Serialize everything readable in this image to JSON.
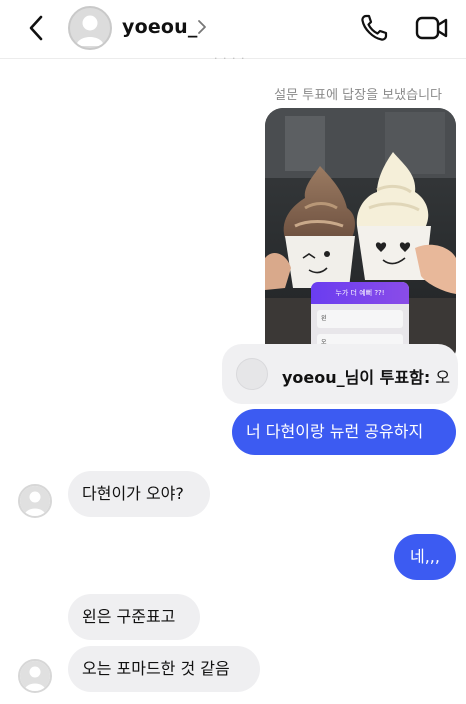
{
  "header": {
    "username": "yoeou_",
    "back_icon": "chevron-left-icon",
    "profile_chevron": "chevron-right-icon",
    "call_icon": "phone-icon",
    "video_icon": "video-camera-icon"
  },
  "thread": {
    "story_reply_meta": "설문 투표에 답장을 보냈습니다",
    "story": {
      "poll_question": "누가 더 예뻐 ??!",
      "poll_options": [
        "왼",
        "오"
      ]
    },
    "vote": {
      "prefix": "yoeou_님이 투표함:",
      "choice": "오"
    },
    "messages": [
      {
        "from": "me",
        "text": "너 다현이랑 뉴런 공유하지"
      },
      {
        "from": "them",
        "text": "다현이가 오야?"
      },
      {
        "from": "me",
        "text": "네,,,"
      },
      {
        "from": "them",
        "text": "왼은 구준표고"
      },
      {
        "from": "them",
        "text": "오는 포마드한 것 같음"
      }
    ]
  },
  "colors": {
    "outgoing_bubble": "#3c5bf2",
    "incoming_bubble": "#efeff1",
    "poll_header": "#6a3df0"
  }
}
